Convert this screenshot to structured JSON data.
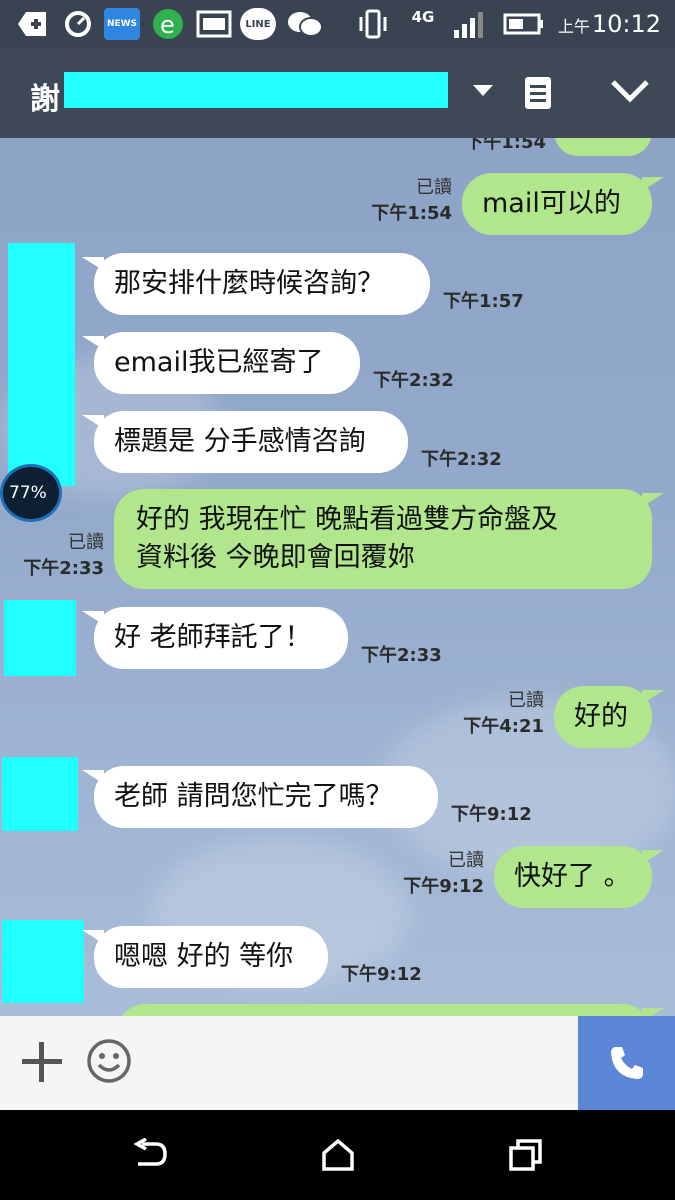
{
  "status_bar": {
    "news_label": "NEWS",
    "line_label": "LINE",
    "network": "4G",
    "time_prefix": "上午",
    "time": "10:12"
  },
  "header": {
    "title_visible": "謝"
  },
  "messages": [
    {
      "side": "out",
      "text": "mail可以的",
      "read": "已讀",
      "time": "下午1:54"
    },
    {
      "side": "in",
      "text": "那安排什麼時候咨詢？",
      "time": "下午1:57"
    },
    {
      "side": "in",
      "text": "email我已經寄了",
      "time": "下午2:32"
    },
    {
      "side": "in",
      "text": "標題是 分手感情咨詢",
      "time": "下午2:32"
    },
    {
      "side": "out",
      "lines": [
        "好的  我現在忙 晚點看過雙方命盤及",
        "資料後 今晚即會回覆妳"
      ],
      "read": "已讀",
      "time": "下午2:33"
    },
    {
      "side": "in",
      "text": "好 老師拜託了！",
      "time": "下午2:33"
    },
    {
      "side": "out",
      "text": "好的",
      "read": "已讀",
      "time": "下午4:21"
    },
    {
      "side": "in",
      "text": "老師 請問您忙完了嗎？",
      "time": "下午9:12"
    },
    {
      "side": "out",
      "text": "快好了 。",
      "read": "已讀",
      "time": "下午9:12"
    },
    {
      "side": "in",
      "text": "嗯嗯 好的 等你",
      "time": "下午9:12"
    }
  ],
  "clipped_top_time": "下午1:54",
  "overlay_widget_text": "77%",
  "colors": {
    "header_bg": "#3f4857",
    "incoming_bubble": "#ffffff",
    "outgoing_bubble": "#b1e68c",
    "redaction": "#21ffff",
    "call_button": "#5c86d6"
  }
}
